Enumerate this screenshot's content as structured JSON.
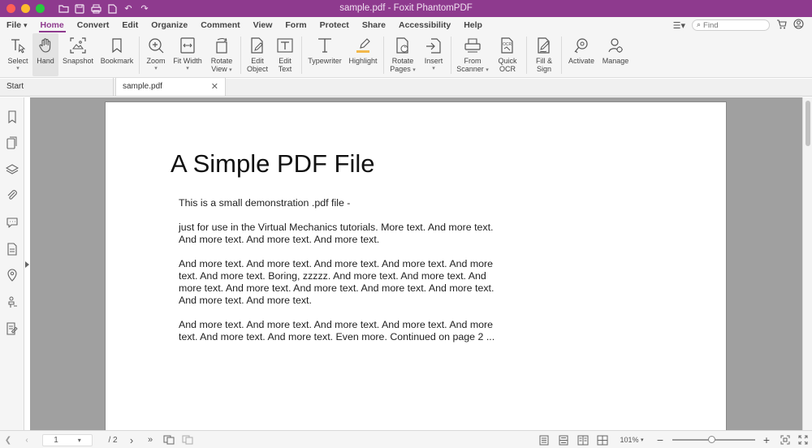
{
  "window": {
    "title": "sample.pdf - Foxit PhantomPDF",
    "traffic_colors": [
      "#ff5f57",
      "#febc2e",
      "#28c840"
    ]
  },
  "menu": {
    "items": [
      "File",
      "Home",
      "Convert",
      "Edit",
      "Organize",
      "Comment",
      "View",
      "Form",
      "Protect",
      "Share",
      "Accessibility",
      "Help"
    ],
    "active": "Home",
    "file_chevron": "▾",
    "find_placeholder": "Find"
  },
  "ribbon": {
    "tools": [
      {
        "name": "select",
        "line1": "Select",
        "line2": "",
        "caret": true,
        "icon": "text-select-icon"
      },
      {
        "name": "hand",
        "line1": "Hand",
        "line2": "",
        "caret": false,
        "icon": "hand-icon",
        "selected": true
      },
      {
        "name": "snapshot",
        "line1": "Snapshot",
        "line2": "",
        "caret": false,
        "icon": "snapshot-icon"
      },
      {
        "name": "bookmark",
        "line1": "Bookmark",
        "line2": "",
        "caret": false,
        "icon": "bookmark-icon"
      },
      {
        "name": "zoom",
        "line1": "Zoom",
        "line2": "",
        "caret": true,
        "icon": "zoom-icon"
      },
      {
        "name": "fit-width",
        "line1": "Fit Width",
        "line2": "",
        "caret": true,
        "icon": "fit-width-icon"
      },
      {
        "name": "rotate-view",
        "line1": "Rotate",
        "line2": "View",
        "caret": true,
        "icon": "rotate-view-icon"
      },
      {
        "name": "edit-object",
        "line1": "Edit",
        "line2": "Object",
        "caret": false,
        "icon": "edit-object-icon"
      },
      {
        "name": "edit-text",
        "line1": "Edit",
        "line2": "Text",
        "caret": false,
        "icon": "edit-text-icon"
      },
      {
        "name": "typewriter",
        "line1": "Typewriter",
        "line2": "",
        "caret": false,
        "icon": "typewriter-icon"
      },
      {
        "name": "highlight",
        "line1": "Highlight",
        "line2": "",
        "caret": false,
        "icon": "highlight-icon"
      },
      {
        "name": "rotate-pages",
        "line1": "Rotate",
        "line2": "Pages",
        "caret": true,
        "icon": "rotate-pages-icon"
      },
      {
        "name": "insert",
        "line1": "Insert",
        "line2": "",
        "caret": true,
        "icon": "insert-icon"
      },
      {
        "name": "from-scanner",
        "line1": "From",
        "line2": "Scanner",
        "caret": true,
        "icon": "scanner-icon"
      },
      {
        "name": "quick-ocr",
        "line1": "Quick",
        "line2": "OCR",
        "caret": false,
        "icon": "ocr-icon"
      },
      {
        "name": "fill-sign",
        "line1": "Fill &",
        "line2": "Sign",
        "caret": false,
        "icon": "fill-sign-icon"
      },
      {
        "name": "activate",
        "line1": "Activate",
        "line2": "",
        "caret": false,
        "icon": "activate-icon"
      },
      {
        "name": "manage",
        "line1": "Manage",
        "line2": "",
        "caret": false,
        "icon": "manage-icon"
      }
    ],
    "ocr_badge": "OCR",
    "accent_color": "#8e3a8e"
  },
  "tabs": {
    "start": "Start",
    "document": "sample.pdf"
  },
  "document": {
    "heading": "A Simple PDF File",
    "paragraphs": [
      "This is a small demonstration .pdf file -",
      "just for use in the Virtual Mechanics tutorials. More text. And more text. And more text. And more text. And more text.",
      "And more text. And more text. And more text. And more text. And more text. And more text. Boring, zzzzz. And more text. And more text. And more text. And more text. And more text. And more text. And more text. And more text. And more text.",
      "And more text. And more text. And more text. And more text. And more text. And more text. And more text. Even more. Continued on page 2 ..."
    ]
  },
  "status": {
    "page_current": "1",
    "page_total": "/ 2",
    "zoom": "101%",
    "zoom_level_percent": 101
  }
}
